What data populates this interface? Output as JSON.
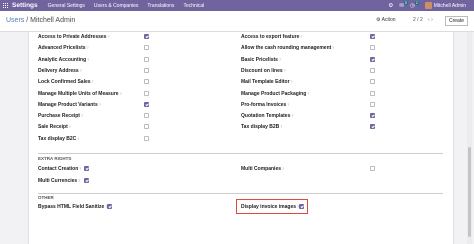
{
  "navbar": {
    "title": "Settings",
    "menus": [
      "General Settings",
      "Users & Companies",
      "Translations",
      "Technical"
    ],
    "messages_count": "5",
    "activity_count": "2",
    "user_name": "Mitchell Admin"
  },
  "control": {
    "breadcrumb_parent": "Users",
    "breadcrumb_sep": " / ",
    "breadcrumb_current": "Mitchell Admin",
    "action_label": "Action",
    "pager": "2 / 2",
    "create_label": "Create"
  },
  "rights_left": [
    {
      "label": "Access to Private Addresses",
      "help": "?",
      "checked": true
    },
    {
      "label": "Advanced Pricelists",
      "help": "?",
      "checked": false
    },
    {
      "label": "Analytic Accounting",
      "help": "?",
      "checked": false
    },
    {
      "label": "Delivery Address",
      "help": "?",
      "checked": false
    },
    {
      "label": "Lock Confirmed Sales",
      "help": "?",
      "checked": false
    },
    {
      "label": "Manage Multiple Units of Measure",
      "help": "?",
      "checked": false
    },
    {
      "label": "Manage Product Variants",
      "help": "?",
      "checked": true
    },
    {
      "label": "Purchase Receipt",
      "help": "?",
      "checked": false
    },
    {
      "label": "Sale Receipt",
      "help": "?",
      "checked": false
    },
    {
      "label": "Tax display B2C",
      "help": "?",
      "checked": false
    }
  ],
  "rights_right": [
    {
      "label": "Access to export feature",
      "help": "?",
      "checked": true
    },
    {
      "label": "Allow the cash rounding management",
      "help": "?",
      "checked": false
    },
    {
      "label": "Basic Pricelists",
      "help": "?",
      "checked": true
    },
    {
      "label": "Discount on lines",
      "help": "?",
      "checked": false
    },
    {
      "label": "Mail Template Editor",
      "help": "?",
      "checked": false
    },
    {
      "label": "Manage Product Packaging",
      "help": "?",
      "checked": false
    },
    {
      "label": "Pro-forma Invoices",
      "help": "?",
      "checked": false
    },
    {
      "label": "Quotation Templates",
      "help": "?",
      "checked": true
    },
    {
      "label": "Tax display B2B",
      "help": "?",
      "checked": true
    }
  ],
  "extra_rights": {
    "title": "EXTRA RIGHTS",
    "contact_creation": {
      "label": "Contact Creation",
      "help": "?",
      "checked": true
    },
    "multi_companies": {
      "label": "Multi Companies",
      "help": "?",
      "checked": false
    },
    "multi_currencies": {
      "label": "Multi Currencies",
      "help": "?",
      "checked": true
    }
  },
  "other": {
    "title": "OTHER",
    "bypass": {
      "label": "Bypass HTML Field Sanitize",
      "help": "?",
      "checked": true
    },
    "invoice_images": {
      "label": "Display invoice images",
      "help": "?",
      "checked": true
    }
  }
}
